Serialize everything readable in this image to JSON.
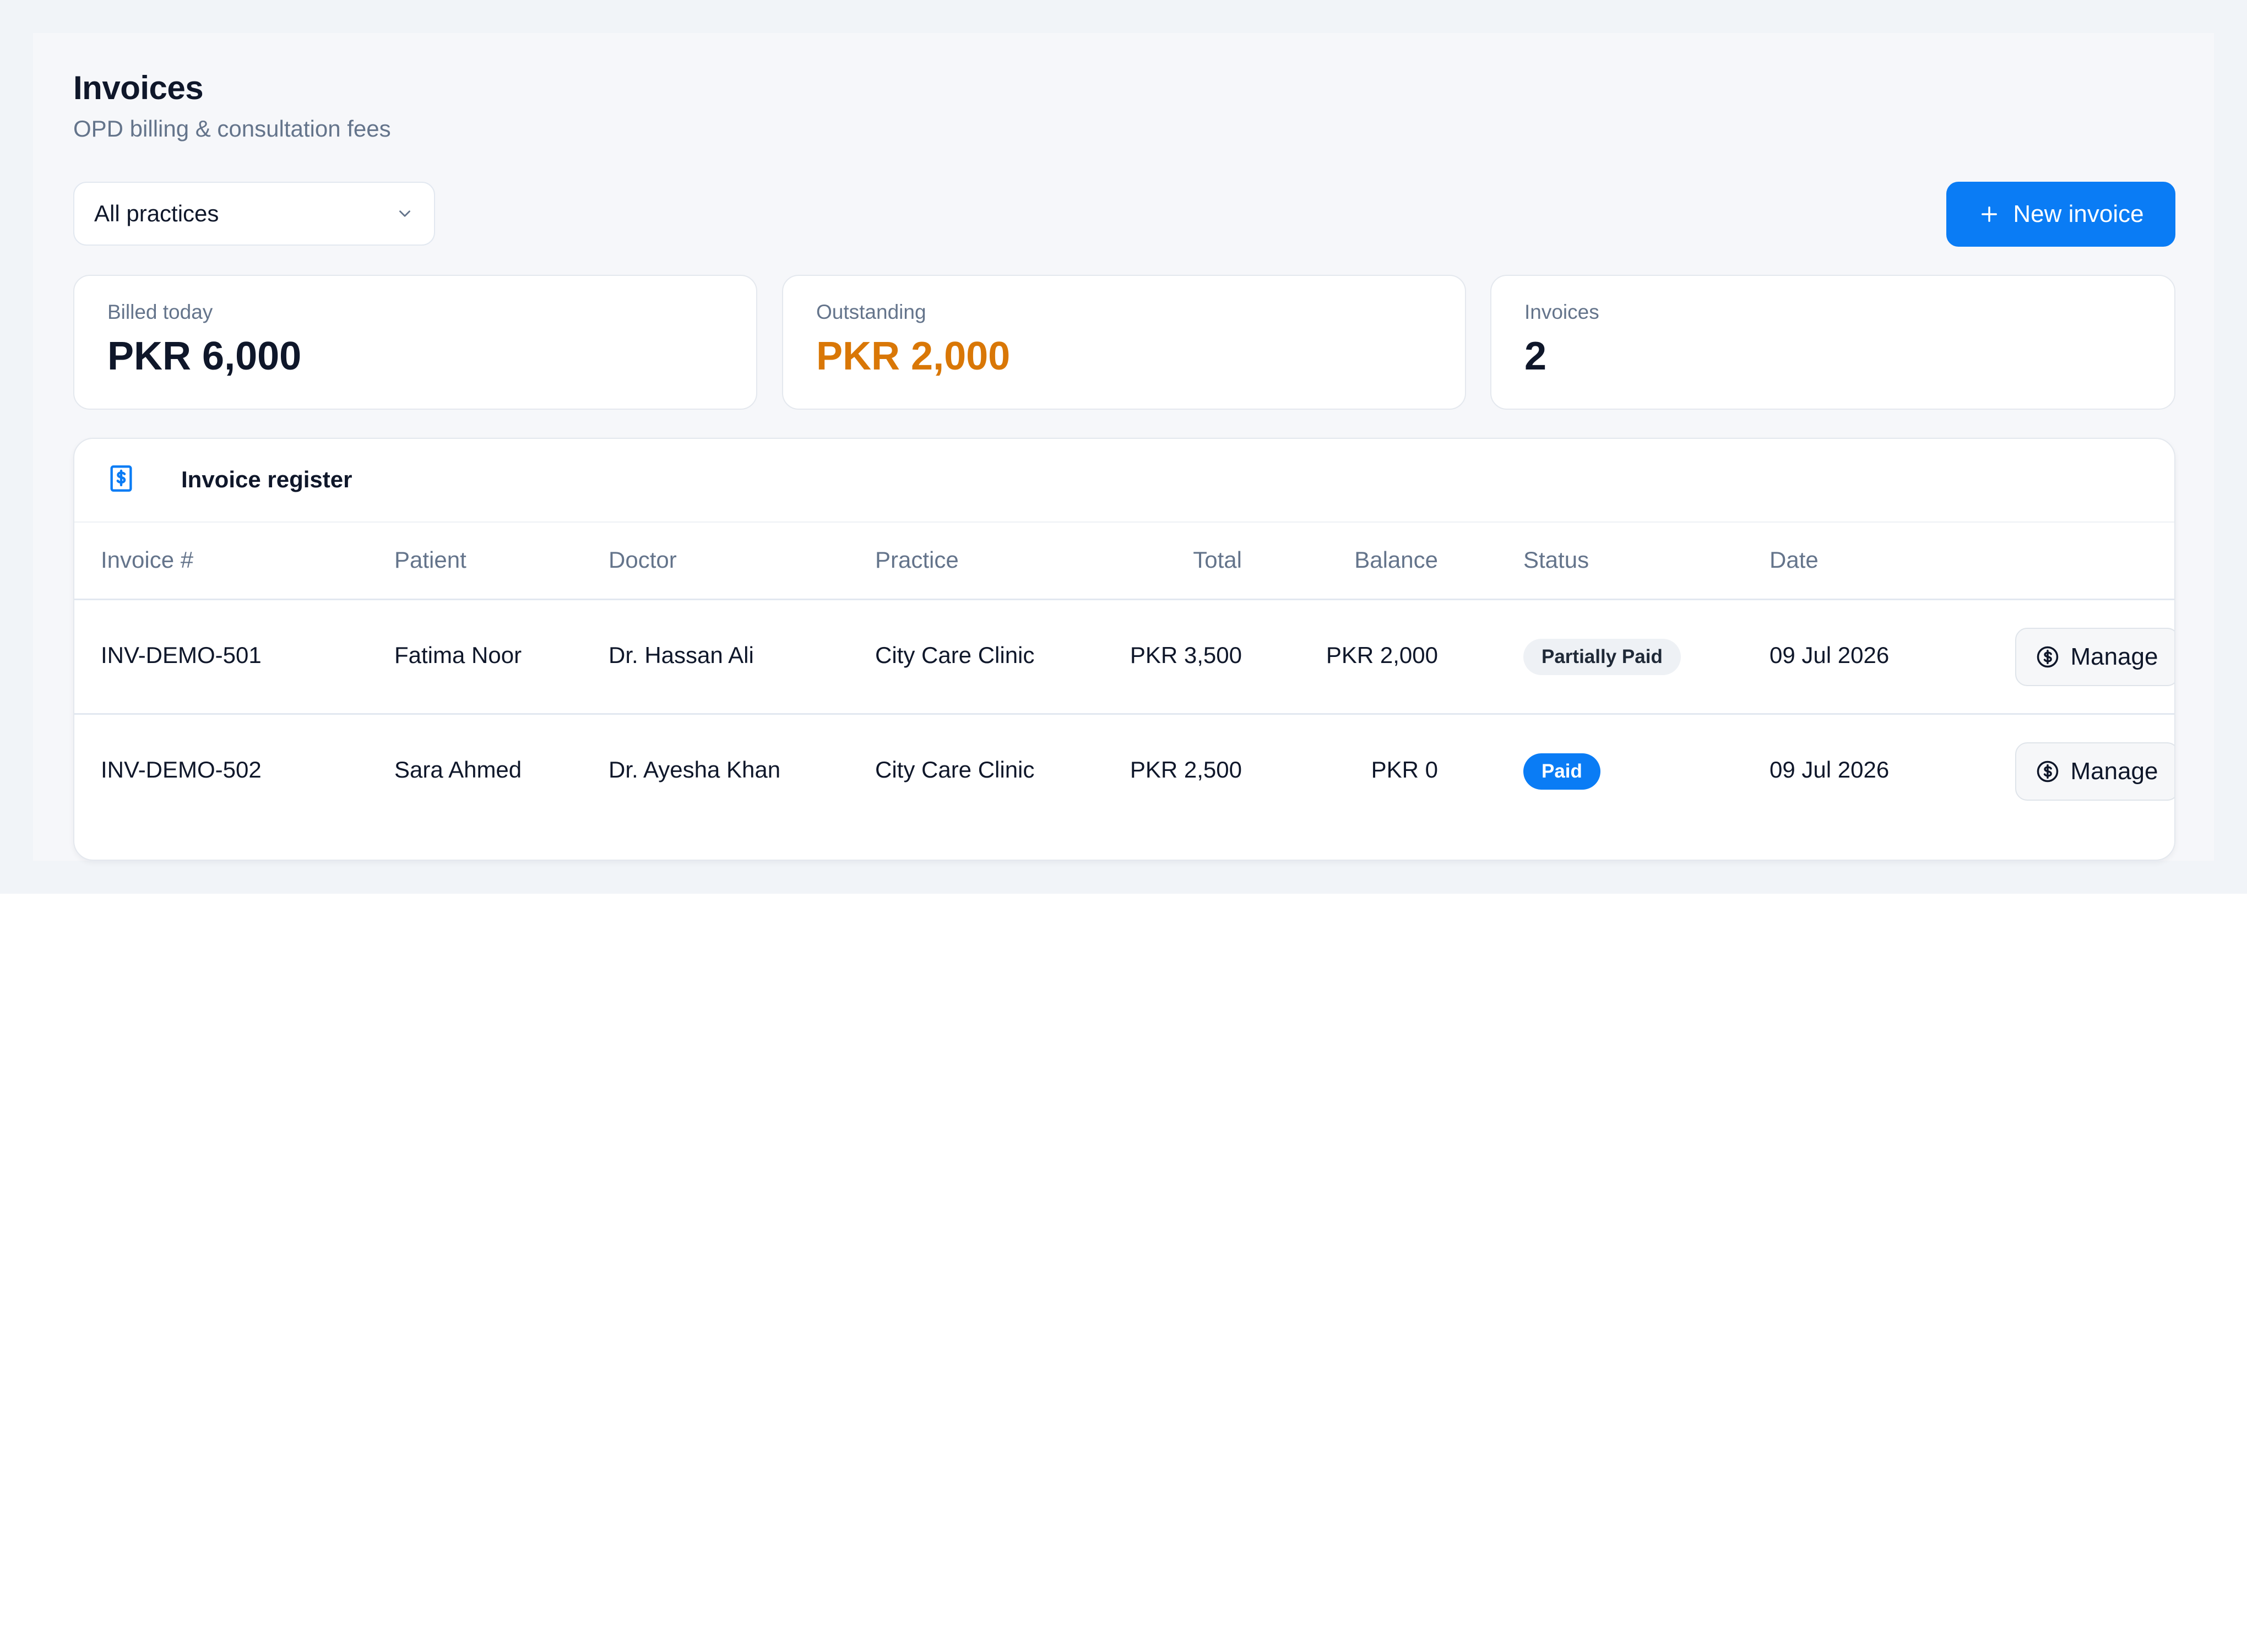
{
  "header": {
    "title": "Invoices",
    "subtitle": "OPD billing & consultation fees"
  },
  "filter": {
    "selected": "All practices",
    "icon": "chevron-down-icon"
  },
  "actions": {
    "new_invoice_label": "New invoice",
    "new_invoice_icon": "plus-icon",
    "accent_color": "#0a7cf5"
  },
  "stats": [
    {
      "label": "Billed today",
      "value": "PKR 6,000"
    },
    {
      "label": "Outstanding",
      "value": "PKR 2,000",
      "color": "#d97706"
    },
    {
      "label": "Invoices",
      "value": "2"
    }
  ],
  "register": {
    "title": "Invoice register",
    "icon": "invoice-icon",
    "columns": [
      "Invoice #",
      "Patient",
      "Doctor",
      "Practice",
      "Total",
      "Balance",
      "Status",
      "Date"
    ],
    "rows": [
      {
        "invoice": "INV-DEMO-501",
        "patient": "Fatima Noor",
        "doctor": "Dr. Hassan Ali",
        "practice": "City Care Clinic",
        "total": "PKR 3,500",
        "balance": "PKR 2,000",
        "status": "Partially Paid",
        "date": "09 Jul 2026",
        "action": "Manage"
      },
      {
        "invoice": "INV-DEMO-502",
        "patient": "Sara Ahmed",
        "doctor": "Dr. Ayesha Khan",
        "practice": "City Care Clinic",
        "total": "PKR 2,500",
        "balance": "PKR 0",
        "status": "Paid",
        "date": "09 Jul 2026",
        "action": "Manage"
      }
    ]
  }
}
